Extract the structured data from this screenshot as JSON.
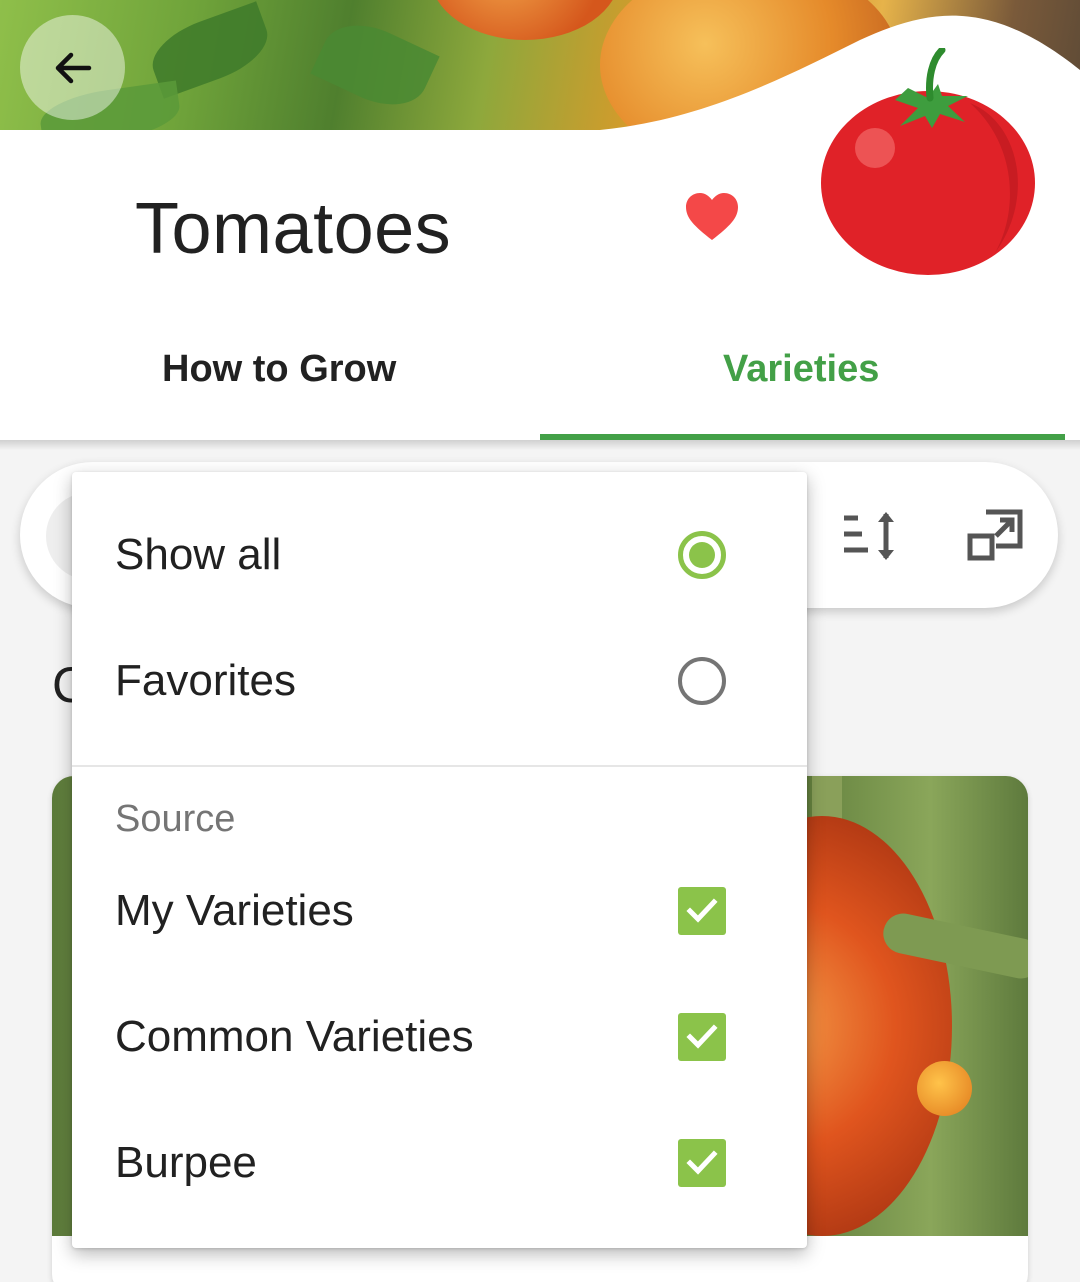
{
  "header": {
    "title": "Tomatoes",
    "favorite": true
  },
  "tabs": [
    {
      "label": "How to Grow",
      "selected": false
    },
    {
      "label": "Varieties",
      "selected": true
    }
  ],
  "filter_menu": {
    "view_options": [
      {
        "label": "Show all",
        "selected": true
      },
      {
        "label": "Favorites",
        "selected": false
      }
    ],
    "source_header": "Source",
    "sources": [
      {
        "label": "My Varieties",
        "checked": true
      },
      {
        "label": "Common Varieties",
        "checked": true
      },
      {
        "label": "Burpee",
        "checked": true
      }
    ]
  },
  "behind_menu": {
    "section_heading_visible_fragment": "C"
  },
  "colors": {
    "accent_green": "#43a047",
    "control_green": "#8bc34a",
    "heart_red": "#f44848",
    "tomato_red": "#e02228"
  },
  "icons": [
    "back-arrow-icon",
    "heart-icon",
    "tomato-illustration",
    "sort-icon",
    "expand-icon",
    "radio-checked-icon",
    "radio-unchecked-icon",
    "checkbox-checked-icon"
  ]
}
